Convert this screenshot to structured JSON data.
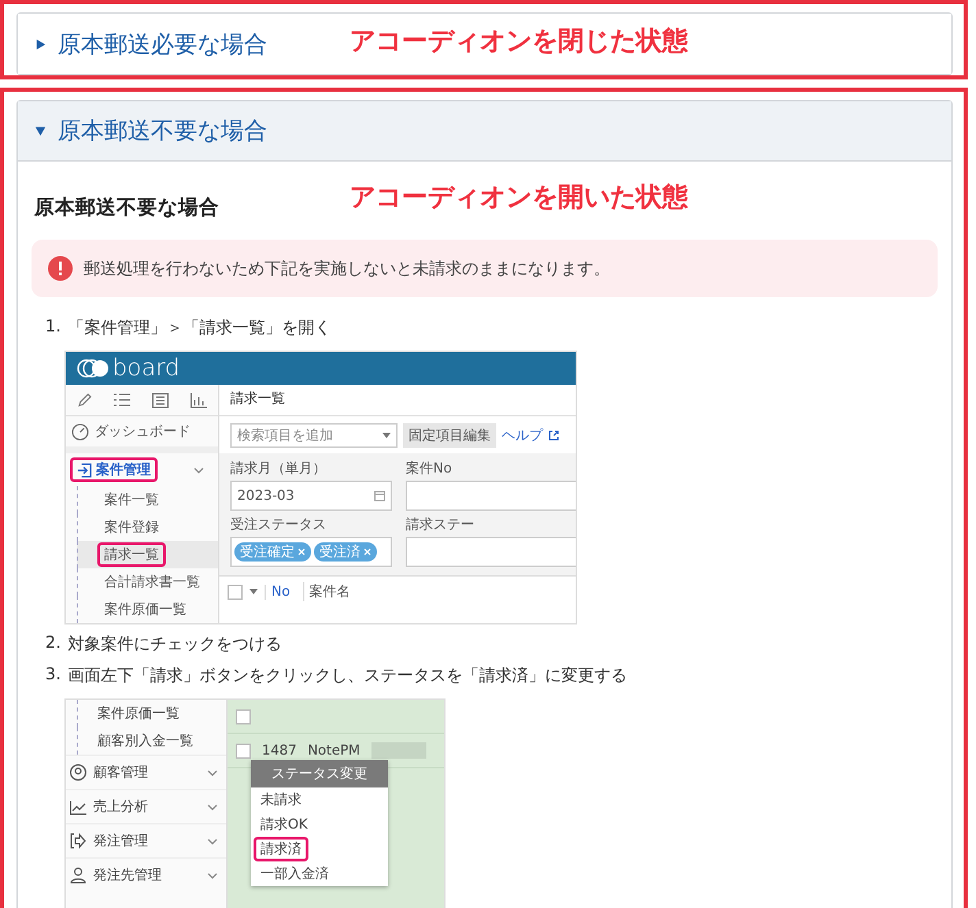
{
  "accordions": [
    {
      "title": "原本郵送必要な場合",
      "expanded": false,
      "note": "アコーディオンを閉じた状態"
    },
    {
      "title": "原本郵送不要な場合",
      "expanded": true,
      "note": "アコーディオンを開いた状態",
      "heading": "原本郵送不要な場合",
      "alert": "郵送処理を行わないため下記を実施しないと未請求のままになります。",
      "steps": [
        {
          "number": "1.",
          "text": "「案件管理」＞「請求一覧」を開く",
          "screen": {
            "kind": "invoice-list",
            "logo": "board",
            "dashboard": "ダッシュボード",
            "menu_group": {
              "label": "案件管理",
              "highlighted": true
            },
            "menu_items": [
              {
                "label": "案件一覧",
                "selected": false,
                "highlighted": false
              },
              {
                "label": "案件登録",
                "selected": false,
                "highlighted": false
              },
              {
                "label": "請求一覧",
                "selected": true,
                "highlighted": true
              },
              {
                "label": "合計請求書一覧",
                "selected": false,
                "highlighted": false
              },
              {
                "label": "案件原価一覧",
                "selected": false,
                "highlighted": false
              }
            ],
            "page_title": "請求一覧",
            "search": {
              "placeholder": "検索項目を追加"
            },
            "edit_button": "固定項目編集",
            "help_link": "ヘルプ",
            "month_field": {
              "label": "請求月（単月）",
              "value": "2023-03"
            },
            "no_field": {
              "label": "案件No"
            },
            "order_status": {
              "label": "受注ステータス",
              "tags": [
                "受注確定",
                "受注済"
              ]
            },
            "invoice_status_label": "請求ステー",
            "columns": [
              "No",
              "案件名"
            ],
            "header_checkbox": {
              "checked": false
            }
          }
        },
        {
          "number": "2.",
          "text": "対象案件にチェックをつける"
        },
        {
          "number": "3.",
          "text": "画面左下「請求」ボタンをクリックし、ステータスを「請求済」に変更する",
          "screen": {
            "kind": "status-menu",
            "menu_items": [
              {
                "kind": "sub",
                "label": "案件原価一覧"
              },
              {
                "kind": "sub",
                "label": "顧客別入金一覧"
              },
              {
                "kind": "group",
                "label": "顧客管理"
              },
              {
                "kind": "group",
                "label": "売上分析"
              },
              {
                "kind": "group",
                "label": "発注管理"
              },
              {
                "kind": "group",
                "label": "発注先管理"
              }
            ],
            "rows": [
              {
                "checked": false
              },
              {
                "checked": false,
                "no": "1487",
                "name": "NotePM"
              }
            ],
            "popup": {
              "title": "ステータス変更",
              "options": [
                {
                  "label": "未請求",
                  "highlighted": false
                },
                {
                  "label": "請求OK",
                  "highlighted": false
                },
                {
                  "label": "請求済",
                  "highlighted": true
                },
                {
                  "label": "一部入金済",
                  "highlighted": false
                }
              ]
            }
          }
        }
      ]
    }
  ]
}
